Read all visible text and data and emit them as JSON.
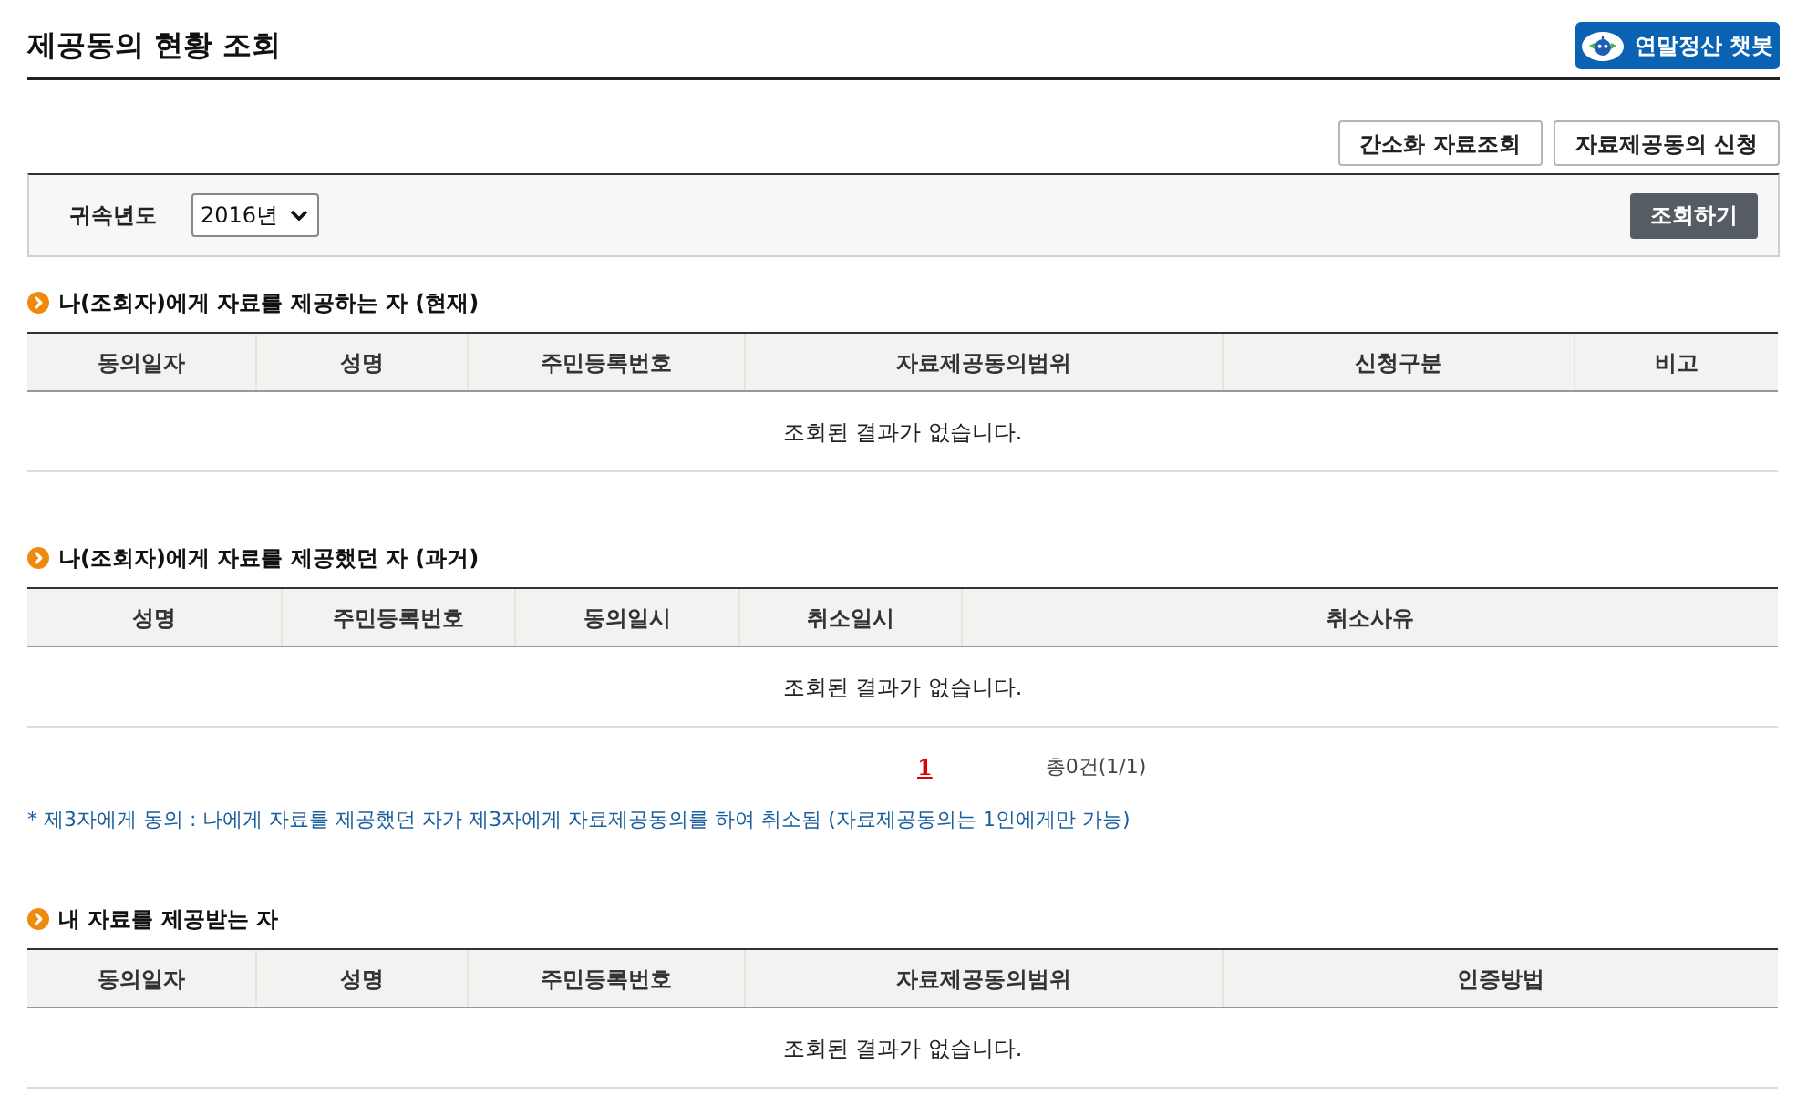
{
  "header": {
    "title": "제공동의 현황 조회",
    "chatbot_button": "연말정산 챗봇"
  },
  "actions": [
    "간소화 자료조회",
    "자료제공동의 신청"
  ],
  "search": {
    "label": "귀속년도",
    "year": "2016년",
    "button": "조회하기"
  },
  "sections": [
    {
      "title": "나(조회자)에게 자료를 제공하는 자 (현재)",
      "columns": [
        "동의일자",
        "성명",
        "주민등록번호",
        "자료제공동의범위",
        "신청구분",
        "비고"
      ],
      "empty_message": "조회된 결과가 없습니다."
    },
    {
      "title": "나(조회자)에게 자료를 제공했던 자 (과거)",
      "columns": [
        "성명",
        "주민등록번호",
        "동의일시",
        "취소일시",
        "취소사유"
      ],
      "empty_message": "조회된 결과가 없습니다.",
      "pagination": {
        "pages": [
          {
            "label": "1",
            "selected": true
          }
        ],
        "total": "총0건(1/1)"
      },
      "note": "* 제3자에게 동의 : 나에게 자료를 제공했던 자가 제3자에게 자료제공동의를 하여 취소됨 (자료제공동의는 1인에게만 가능)"
    },
    {
      "title": "내 자료를 제공받는 자",
      "columns": [
        "동의일자",
        "성명",
        "주민등록번호",
        "자료제공동의범위",
        "인증방법"
      ],
      "empty_message": "조회된 결과가 없습니다."
    }
  ]
}
